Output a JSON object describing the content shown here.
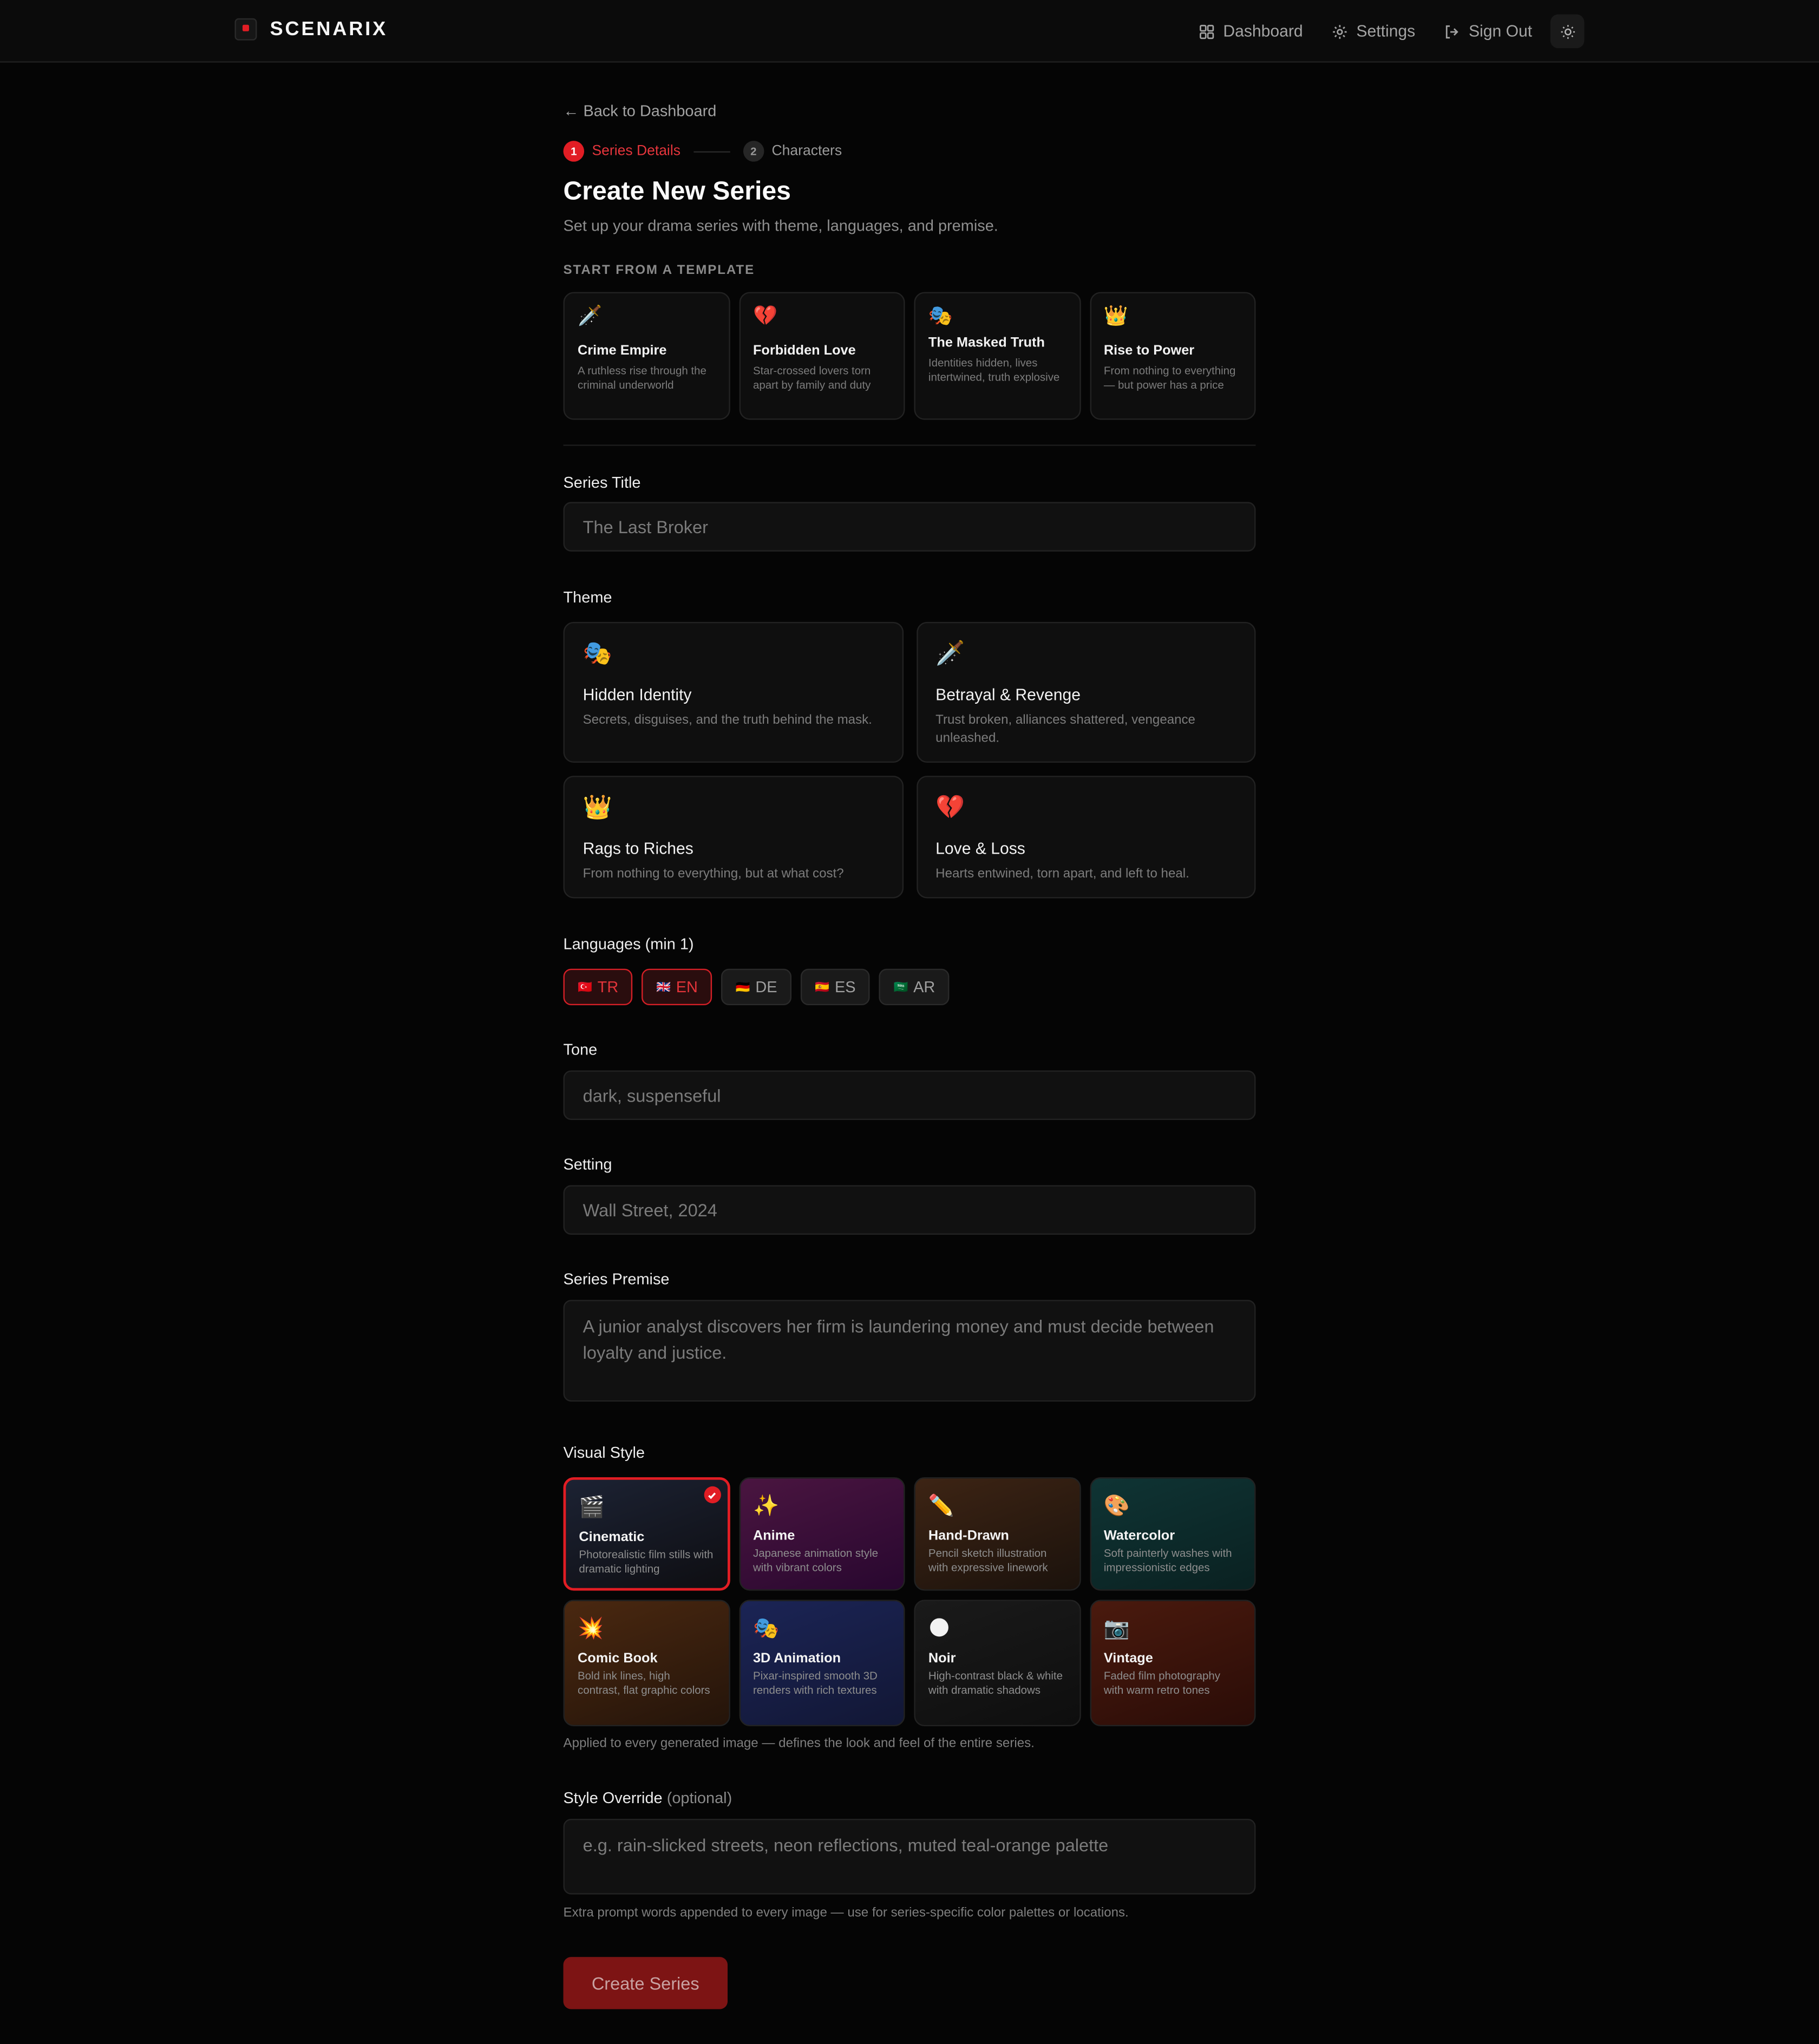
{
  "header": {
    "brand": "SCENARIX",
    "nav": [
      {
        "label": "Dashboard",
        "icon": "grid-icon"
      },
      {
        "label": "Settings",
        "icon": "gear-icon"
      },
      {
        "label": "Sign Out",
        "icon": "sign-out-icon"
      }
    ],
    "theme_toggle_icon": "sun-icon"
  },
  "back_link": "← Back to Dashboard",
  "stepper": [
    {
      "num": "1",
      "label": "Series Details",
      "active": true
    },
    {
      "num": "2",
      "label": "Characters",
      "active": false
    }
  ],
  "page_title": "Create New Series",
  "page_subtitle": "Set up your drama series with theme, languages, and premise.",
  "templates_caption": "START FROM A TEMPLATE",
  "templates": [
    {
      "emoji": "🗡️",
      "name": "Crime Empire",
      "desc": "A ruthless rise through the criminal underworld"
    },
    {
      "emoji": "💔",
      "name": "Forbidden Love",
      "desc": "Star-crossed lovers torn apart by family and duty"
    },
    {
      "emoji": "🎭",
      "name": "The Masked Truth",
      "desc": "Identities hidden, lives intertwined, truth explosive"
    },
    {
      "emoji": "👑",
      "name": "Rise to Power",
      "desc": "From nothing to everything — but power has a price"
    }
  ],
  "series_title": {
    "label": "Series Title",
    "placeholder": "The Last Broker"
  },
  "theme": {
    "label": "Theme",
    "options": [
      {
        "emoji": "🎭",
        "name": "Hidden Identity",
        "desc": "Secrets, disguises, and the truth behind the mask."
      },
      {
        "emoji": "🗡️",
        "name": "Betrayal & Revenge",
        "desc": "Trust broken, alliances shattered, vengeance unleashed."
      },
      {
        "emoji": "👑",
        "name": "Rags to Riches",
        "desc": "From nothing to everything, but at what cost?"
      },
      {
        "emoji": "💔",
        "name": "Love & Loss",
        "desc": "Hearts entwined, torn apart, and left to heal."
      }
    ]
  },
  "languages": {
    "label": "Languages (min 1)",
    "options": [
      {
        "flag": "🇹🇷",
        "code": "TR",
        "selected": true
      },
      {
        "flag": "🇬🇧",
        "code": "EN",
        "selected": true
      },
      {
        "flag": "🇩🇪",
        "code": "DE",
        "selected": false
      },
      {
        "flag": "🇪🇸",
        "code": "ES",
        "selected": false
      },
      {
        "flag": "🇸🇦",
        "code": "AR",
        "selected": false
      }
    ]
  },
  "tone": {
    "label": "Tone",
    "placeholder": "dark, suspenseful"
  },
  "setting": {
    "label": "Setting",
    "placeholder": "Wall Street, 2024"
  },
  "premise": {
    "label": "Series Premise",
    "placeholder": "A junior analyst discovers her firm is laundering money and must decide between loyalty and justice."
  },
  "visual_style": {
    "label": "Visual Style",
    "options": [
      {
        "emoji": "🎬",
        "name": "Cinematic",
        "desc": "Photorealistic film stills with dramatic lighting",
        "selected": true
      },
      {
        "emoji": "✨",
        "name": "Anime",
        "desc": "Japanese animation style with vibrant colors",
        "selected": false
      },
      {
        "emoji": "✏️",
        "name": "Hand-Drawn",
        "desc": "Pencil sketch illustration with expressive linework",
        "selected": false
      },
      {
        "emoji": "🎨",
        "name": "Watercolor",
        "desc": "Soft painterly washes with impressionistic edges",
        "selected": false
      },
      {
        "emoji": "💥",
        "name": "Comic Book",
        "desc": "Bold ink lines, high contrast, flat graphic colors",
        "selected": false
      },
      {
        "emoji": "🎭",
        "name": "3D Animation",
        "desc": "Pixar-inspired smooth 3D renders with rich textures",
        "selected": false
      },
      {
        "emoji": "🌑",
        "name": "Noir",
        "desc": "High-contrast black & white with dramatic shadows",
        "selected": false
      },
      {
        "emoji": "📷",
        "name": "Vintage",
        "desc": "Faded film photography with warm retro tones",
        "selected": false
      }
    ],
    "hint": "Applied to every generated image — defines the look and feel of the entire series."
  },
  "style_override": {
    "label": "Style Override",
    "optional": "(optional)",
    "placeholder": "e.g. rain-slicked streets, neon reflections, muted teal-orange palette",
    "hint": "Extra prompt words appended to every image — use for series-specific color palettes or locations."
  },
  "submit_label": "Create Series",
  "colors": {
    "accent": "#e11d24",
    "background": "#050505",
    "card": "#0f0f0f"
  }
}
